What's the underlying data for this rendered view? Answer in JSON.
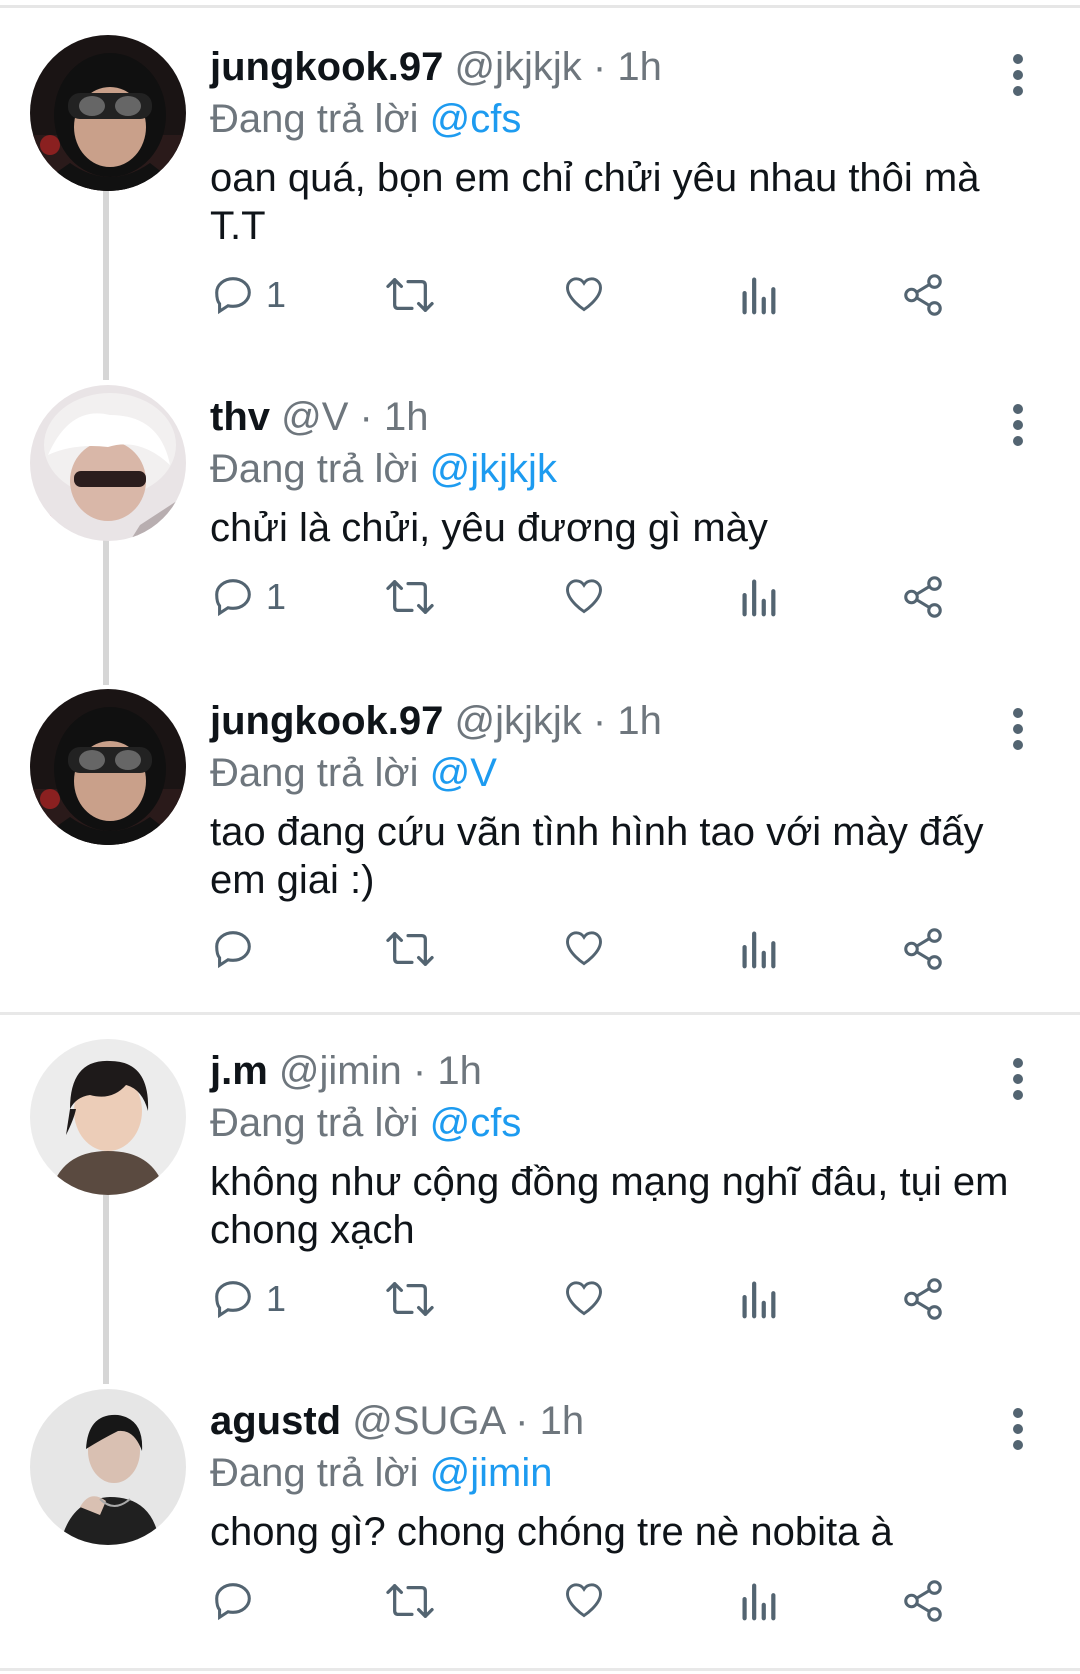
{
  "replying_label": "Đang trả lời",
  "colors": {
    "mention": "#1d9bf0",
    "muted": "#6e767d",
    "text": "#0f1419"
  },
  "tweets": [
    {
      "name": "jungkook.97",
      "handle": "@jkjkjk",
      "dot": "·",
      "time": "1h",
      "reply_to": "@cfs",
      "text": "oan quá, bọn em chỉ chửi yêu nhau thôi mà T.T",
      "reply_count": "1",
      "avatar": "helmet-avatar"
    },
    {
      "name": "thv",
      "handle": "@V",
      "dot": "·",
      "time": "1h",
      "reply_to": "@jkjkjk",
      "text": "chửi là chửi, yêu đương gì mày",
      "reply_count": "1",
      "avatar": "white-hair-avatar"
    },
    {
      "name": "jungkook.97",
      "handle": "@jkjkjk",
      "dot": "·",
      "time": "1h",
      "reply_to": "@V",
      "text": "tao đang cứu vãn tình hình tao với mày đấy em giai :)",
      "reply_count": "",
      "avatar": "helmet-avatar"
    },
    {
      "name": "j.m",
      "handle": "@jimin",
      "dot": "·",
      "time": "1h",
      "reply_to": "@cfs",
      "text": "không như cộng đồng mạng nghĩ đâu, tụi em chong xạch",
      "reply_count": "1",
      "avatar": "dark-hair-avatar"
    },
    {
      "name": "agustd",
      "handle": "@SUGA",
      "dot": "·",
      "time": "1h",
      "reply_to": "@jimin",
      "text": "chong gì? chong chóng tre nè nobita à",
      "reply_count": "",
      "avatar": "sketch-avatar"
    }
  ]
}
